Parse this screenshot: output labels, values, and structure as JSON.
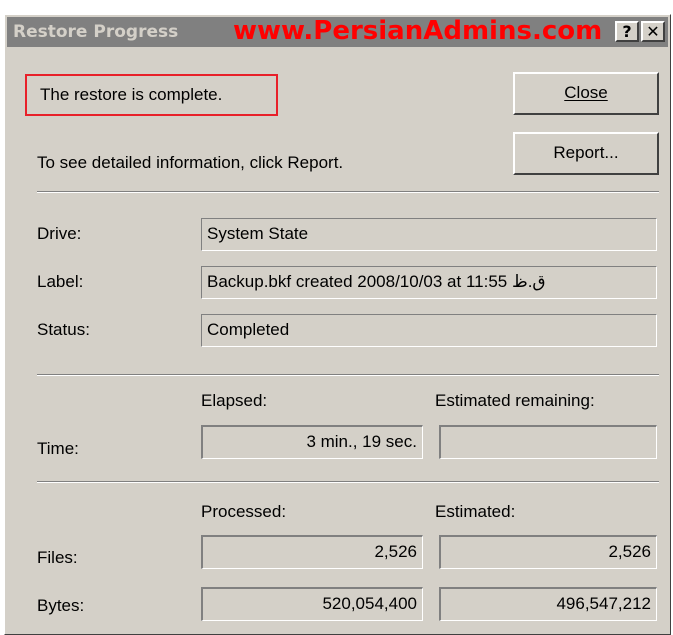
{
  "top_caption": "",
  "window": {
    "title": "Restore Progress",
    "watermark": "www.PersianAdmins.com",
    "help_icon": "question-mark-icon",
    "close_icon": "close-x-icon"
  },
  "status_message": "The restore is complete.",
  "hint": "To see detailed information, click Report.",
  "buttons": {
    "close_label": "Close",
    "report_label": "Report..."
  },
  "info": {
    "drive_label": "Drive:",
    "drive_value": "System State",
    "label_label": "Label:",
    "label_value": "Backup.bkf created 2008/10/03 at 11:55 ق.ظ",
    "status_label": "Status:",
    "status_value": "Completed"
  },
  "time": {
    "row_label": "Time:",
    "elapsed_header": "Elapsed:",
    "remaining_header": "Estimated remaining:",
    "elapsed_value": "3 min., 19 sec.",
    "remaining_value": ""
  },
  "counts": {
    "processed_header": "Processed:",
    "estimated_header": "Estimated:",
    "files_label": "Files:",
    "files_processed": "2,526",
    "files_estimated": "2,526",
    "bytes_label": "Bytes:",
    "bytes_processed": "520,054,400",
    "bytes_estimated": "496,547,212"
  },
  "colors": {
    "dialog_face": "#d4d0c8",
    "titlebar_inactive": "#808080",
    "highlight_border": "#e8202a",
    "watermark": "#ff0000"
  }
}
